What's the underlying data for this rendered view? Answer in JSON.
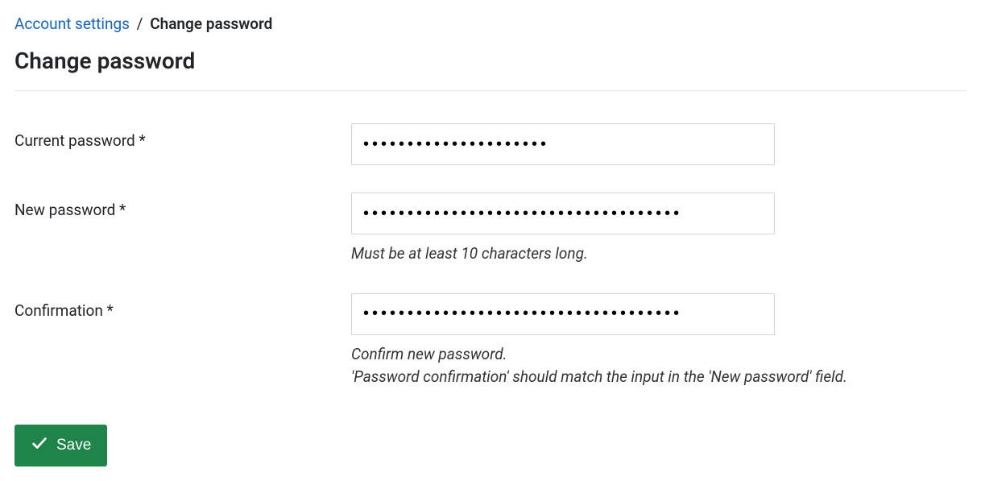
{
  "breadcrumb": {
    "parent_label": "Account settings",
    "separator": "/",
    "current_label": "Change password"
  },
  "page": {
    "title": "Change password"
  },
  "form": {
    "current_password": {
      "label": "Current password *",
      "value": "•••••••••••••••••••••"
    },
    "new_password": {
      "label": "New password *",
      "value": "••••••••••••••••••••••••••••••••••••",
      "help": "Must be at least 10 characters long."
    },
    "confirmation": {
      "label": "Confirmation *",
      "value": "••••••••••••••••••••••••••••••••••••",
      "help_line1": "Confirm new password.",
      "help_line2": "'Password confirmation' should match the input in the 'New password' field."
    },
    "save_label": "Save"
  }
}
